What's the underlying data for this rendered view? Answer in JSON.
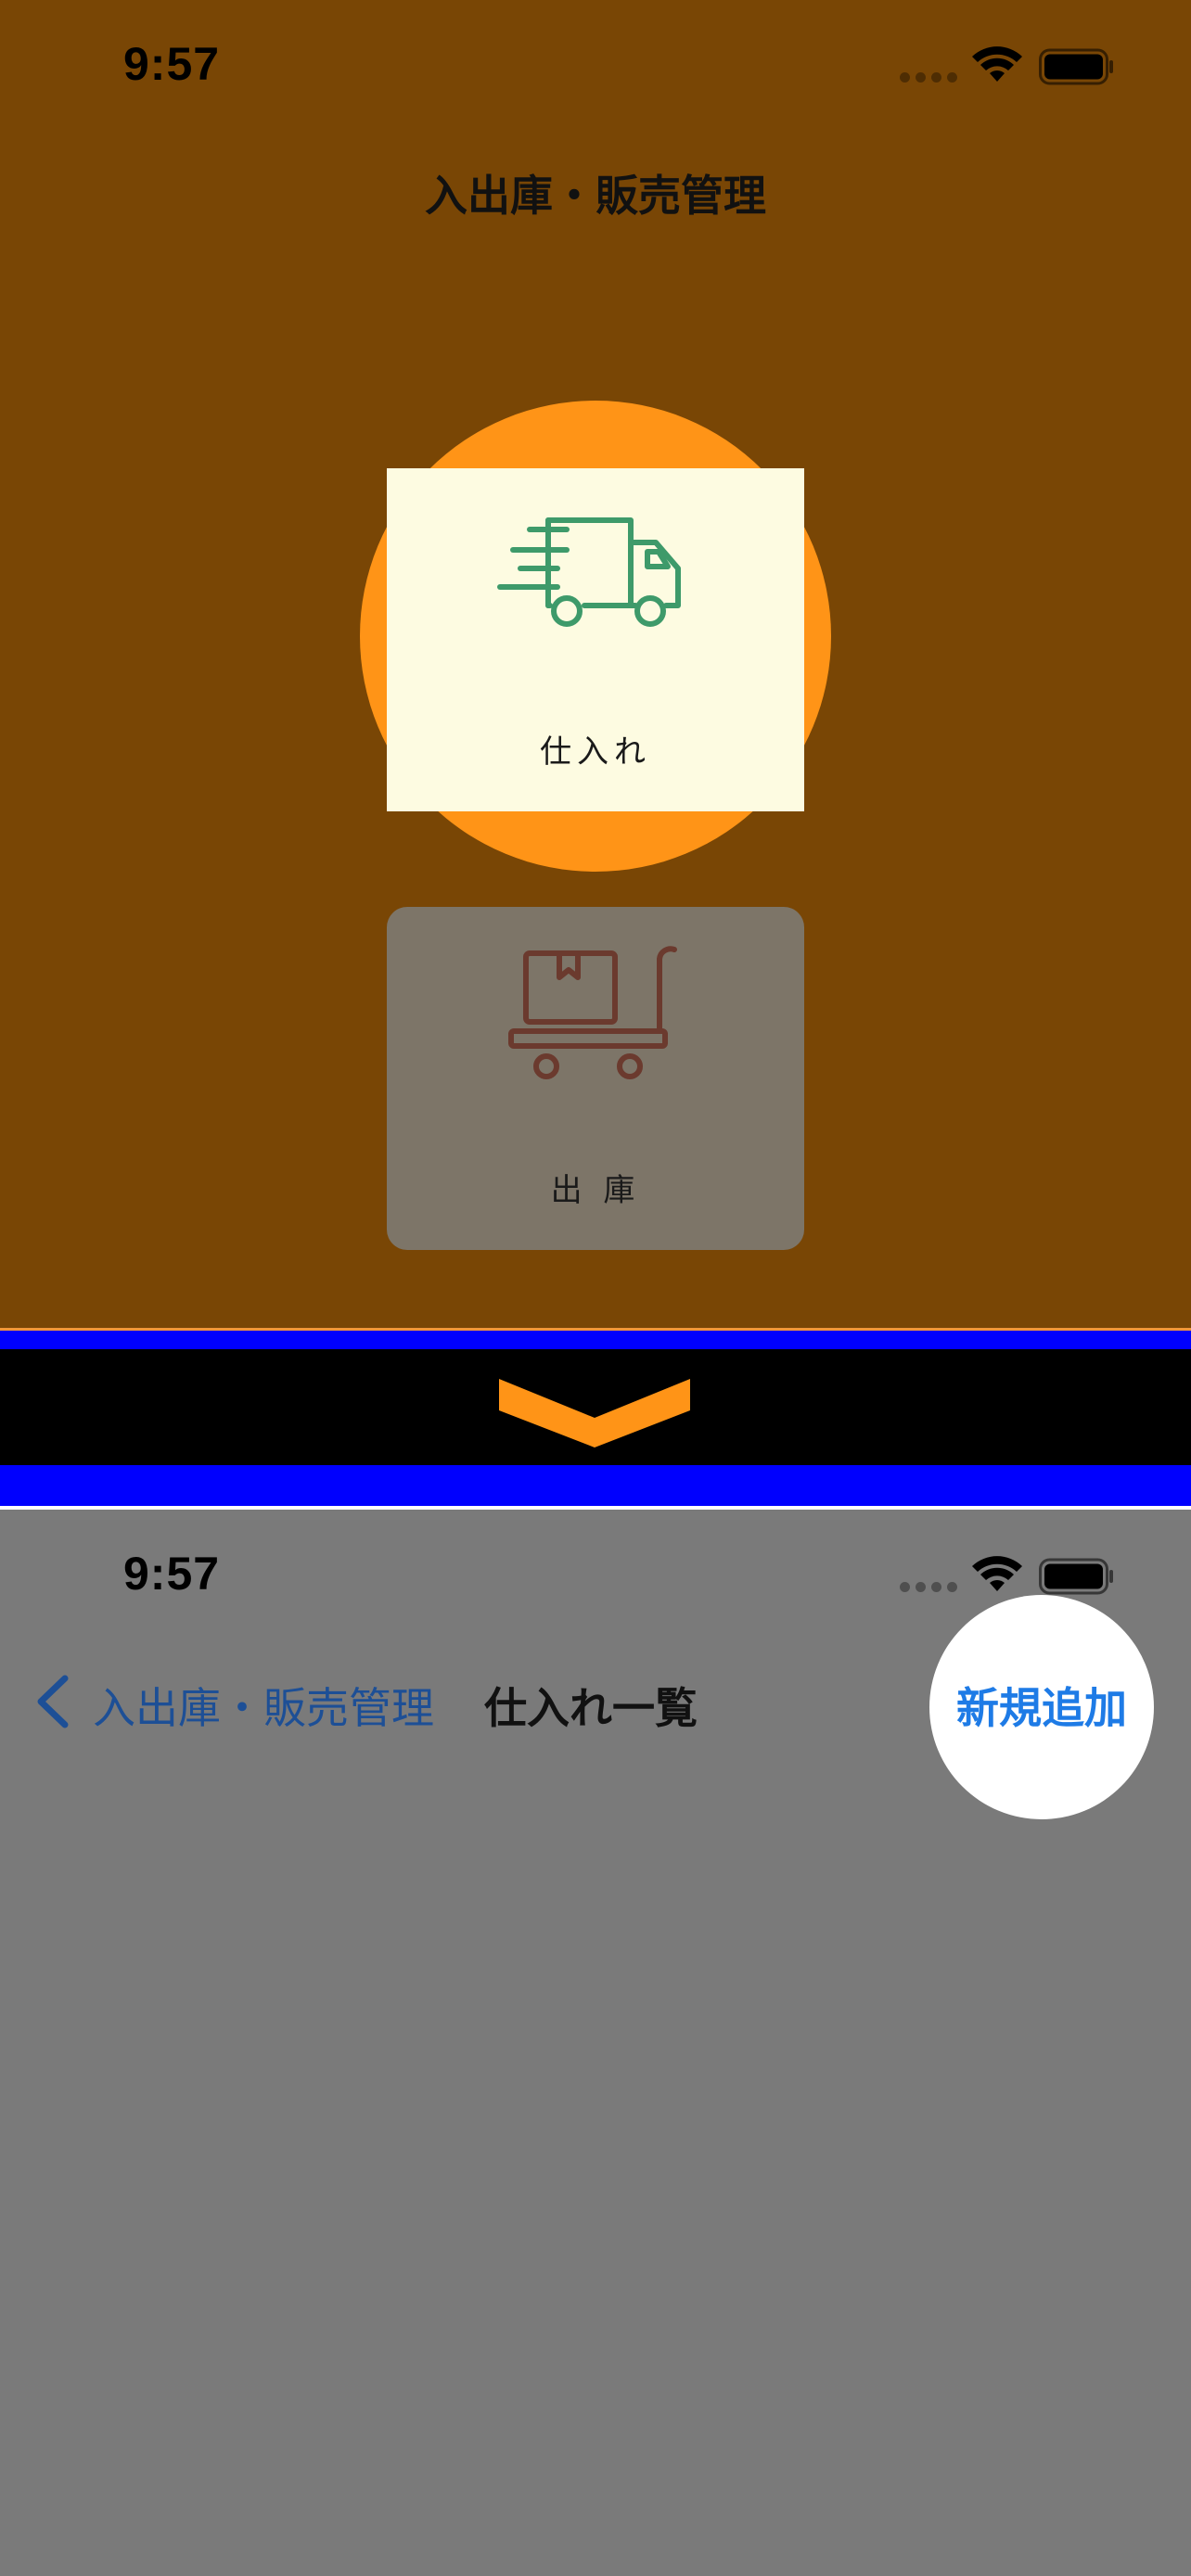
{
  "top_screen": {
    "status_bar": {
      "time": "9:57"
    },
    "title": "入出庫・販売管理",
    "menu": [
      {
        "label": "仕入れ",
        "icon": "truck-icon",
        "highlighted": true
      },
      {
        "label": "出 庫",
        "icon": "hand-cart-icon",
        "highlighted": false
      }
    ]
  },
  "divider": {
    "icon": "chevron-down-icon"
  },
  "bottom_screen": {
    "status_bar": {
      "time": "9:57"
    },
    "nav": {
      "back_label": "入出庫・販売管理",
      "title": "仕入れ一覧",
      "add_button": "新規追加"
    }
  },
  "colors": {
    "top_background": "#794605",
    "spotlight": "#ff9417",
    "highlight_card": "#fdfbe1",
    "card": "#7d7568",
    "truck_stroke": "#3e9a6a",
    "cart_stroke": "#6b3a2e",
    "band_blue": "#0000fe",
    "band_black": "#000000",
    "bottom_background": "#7a7a7a",
    "nav_back": "#1d4f96",
    "add_button_text": "#1e7be6"
  }
}
